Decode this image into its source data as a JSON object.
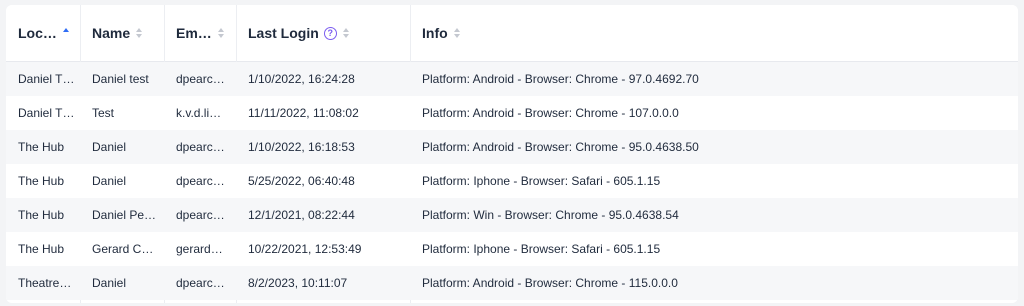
{
  "table": {
    "columns": [
      {
        "key": "location",
        "label": "Loc…",
        "sort": "asc",
        "help": false
      },
      {
        "key": "name",
        "label": "Name",
        "sort": "none",
        "help": false
      },
      {
        "key": "email",
        "label": "Em…",
        "sort": "none",
        "help": false
      },
      {
        "key": "last_login",
        "label": "Last Login",
        "sort": "none",
        "help": true
      },
      {
        "key": "info",
        "label": "Info",
        "sort": "none",
        "help": false
      }
    ],
    "help_glyph": "?",
    "rows": [
      {
        "location": "Daniel T…",
        "name": "Daniel test",
        "email": "dpearc…",
        "last_login": "1/10/2022, 16:24:28",
        "info": "Platform: Android - Browser: Chrome - 97.0.4692.70"
      },
      {
        "location": "Daniel T…",
        "name": "Test",
        "email": "k.v.d.li…",
        "last_login": "11/11/2022, 11:08:02",
        "info": "Platform: Android - Browser: Chrome - 107.0.0.0"
      },
      {
        "location": "The Hub",
        "name": "Daniel",
        "email": "dpearc…",
        "last_login": "1/10/2022, 16:18:53",
        "info": "Platform: Android - Browser: Chrome - 95.0.4638.50"
      },
      {
        "location": "The Hub",
        "name": "Daniel",
        "email": "dpearc…",
        "last_login": "5/25/2022, 06:40:48",
        "info": "Platform: Iphone - Browser: Safari - 605.1.15"
      },
      {
        "location": "The Hub",
        "name": "Daniel Pe…",
        "email": "dpearc…",
        "last_login": "12/1/2021, 08:22:44",
        "info": "Platform: Win - Browser: Chrome - 95.0.4638.54"
      },
      {
        "location": "The Hub",
        "name": "Gerard C…",
        "email": "gerard…",
        "last_login": "10/22/2021, 12:53:49",
        "info": "Platform: Iphone - Browser: Safari - 605.1.15"
      },
      {
        "location": "Theatre…",
        "name": "Daniel",
        "email": "dpearc…",
        "last_login": "8/2/2023, 10:11:07",
        "info": "Platform: Android - Browser: Chrome - 115.0.0.0"
      }
    ]
  },
  "colors": {
    "sort_active": "#2f6df5",
    "help_icon": "#7b5cf0",
    "row_striped": "#f6f7f9"
  }
}
